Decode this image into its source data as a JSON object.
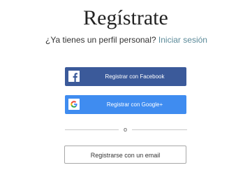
{
  "header": {
    "title": "Regístrate",
    "subtitle_text": "¿Ya tienes un perfil personal?",
    "login_link": "Iniciar sesión"
  },
  "social": {
    "facebook_label": "Registrar con Facebook",
    "facebook_icon": "facebook-icon",
    "facebook_color": "#3b5a9a",
    "google_label": "Registrar con Google+",
    "google_icon": "google-icon",
    "google_color": "#3f8cf0"
  },
  "divider": {
    "text": "o"
  },
  "email": {
    "label": "Registrarse con un email"
  },
  "colors": {
    "link": "#5b8a99"
  }
}
